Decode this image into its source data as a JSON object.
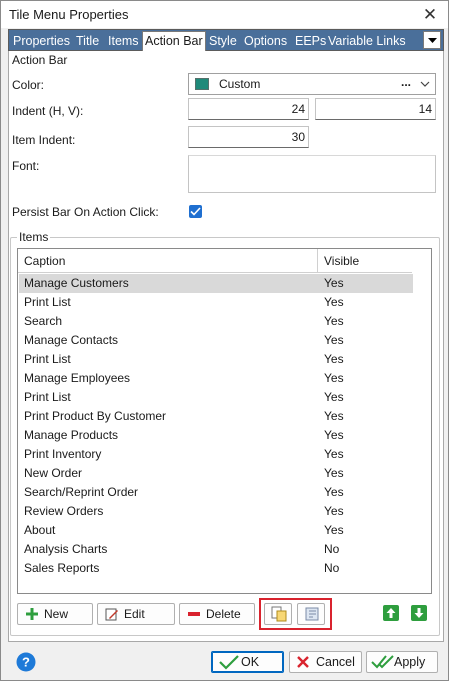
{
  "window": {
    "title": "Tile Menu Properties"
  },
  "tabs": [
    {
      "label": "Properties"
    },
    {
      "label": "Title"
    },
    {
      "label": "Items"
    },
    {
      "label": "Action Bar"
    },
    {
      "label": "Style"
    },
    {
      "label": "Options"
    },
    {
      "label": "EEPs"
    },
    {
      "label": "Variable Links"
    }
  ],
  "active_tab": "Action Bar",
  "action_bar": {
    "group_label": "Action Bar",
    "color_label": "Color:",
    "color_value": "Custom",
    "color_swatch": "#1f8a7a",
    "color_more": "...",
    "indent_label": "Indent (H, V):",
    "indent_h": "24",
    "indent_v": "14",
    "item_indent_label": "Item Indent:",
    "item_indent": "30",
    "font_label": "Font:",
    "persist_label": "Persist Bar On Action Click:",
    "persist_checked": true
  },
  "items": {
    "group_label": "Items",
    "columns": [
      "Caption",
      "Visible"
    ],
    "rows": [
      {
        "caption": "Manage Customers",
        "visible": "Yes"
      },
      {
        "caption": "Print List",
        "visible": "Yes"
      },
      {
        "caption": "Search",
        "visible": "Yes"
      },
      {
        "caption": "Manage Contacts",
        "visible": "Yes"
      },
      {
        "caption": "Print List",
        "visible": "Yes"
      },
      {
        "caption": "Manage Employees",
        "visible": "Yes"
      },
      {
        "caption": "Print List",
        "visible": "Yes"
      },
      {
        "caption": "Print Product By Customer",
        "visible": "Yes"
      },
      {
        "caption": "Manage Products",
        "visible": "Yes"
      },
      {
        "caption": "Print Inventory",
        "visible": "Yes"
      },
      {
        "caption": "New Order",
        "visible": "Yes"
      },
      {
        "caption": "Search/Reprint Order",
        "visible": "Yes"
      },
      {
        "caption": "Review Orders",
        "visible": "Yes"
      },
      {
        "caption": "About",
        "visible": "Yes"
      },
      {
        "caption": "Analysis Charts",
        "visible": "No"
      },
      {
        "caption": "Sales Reports",
        "visible": "No"
      }
    ],
    "selected_index": 0
  },
  "buttons": {
    "new": "New",
    "edit": "Edit",
    "delete": "Delete"
  },
  "footer": {
    "ok": "OK",
    "cancel": "Cancel",
    "apply": "Apply"
  },
  "colors": {
    "tabstrip": "#4a6f9a",
    "highlight_box": "#d9232e",
    "check_blue": "#1f6fd0",
    "arrow_green": "#2e9e3e"
  }
}
